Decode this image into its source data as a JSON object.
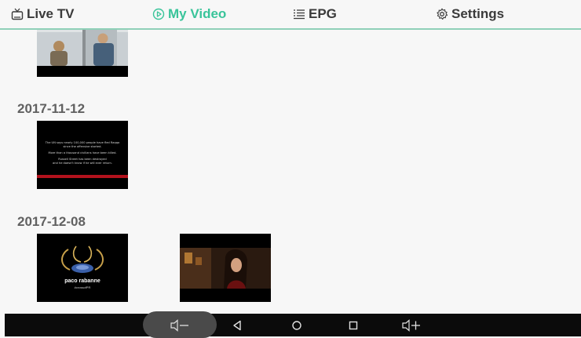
{
  "tabs": [
    {
      "label": "Live TV",
      "icon": "tv-icon",
      "active": false
    },
    {
      "label": "My Video",
      "icon": "play-circle-icon",
      "active": true
    },
    {
      "label": "EPG",
      "icon": "list-icon",
      "active": false
    },
    {
      "label": "Settings",
      "icon": "gear-icon",
      "active": false
    }
  ],
  "groups": [
    {
      "date": "2017-11-12"
    },
    {
      "date": "2017-12-08"
    }
  ],
  "thumb_text": {
    "news_lines": [
      "The UN says nearly 100,000 people have fled Raqqa",
      "since the offensive started.",
      "More than a thousand civilians have been killed.",
      "Russell Street has been destroyed",
      "and he doesn't know if he will ever return."
    ],
    "brand": "paco rabanne",
    "hashtag": "#crossofPR"
  },
  "colors": {
    "accent": "#39c49a",
    "tab_text": "#3a3a3a",
    "date_text": "#616161",
    "divider": "#8fd0b8"
  },
  "navbar": {
    "buttons": [
      "volume-down-icon",
      "back-icon",
      "home-icon",
      "recents-icon",
      "volume-up-icon"
    ]
  }
}
